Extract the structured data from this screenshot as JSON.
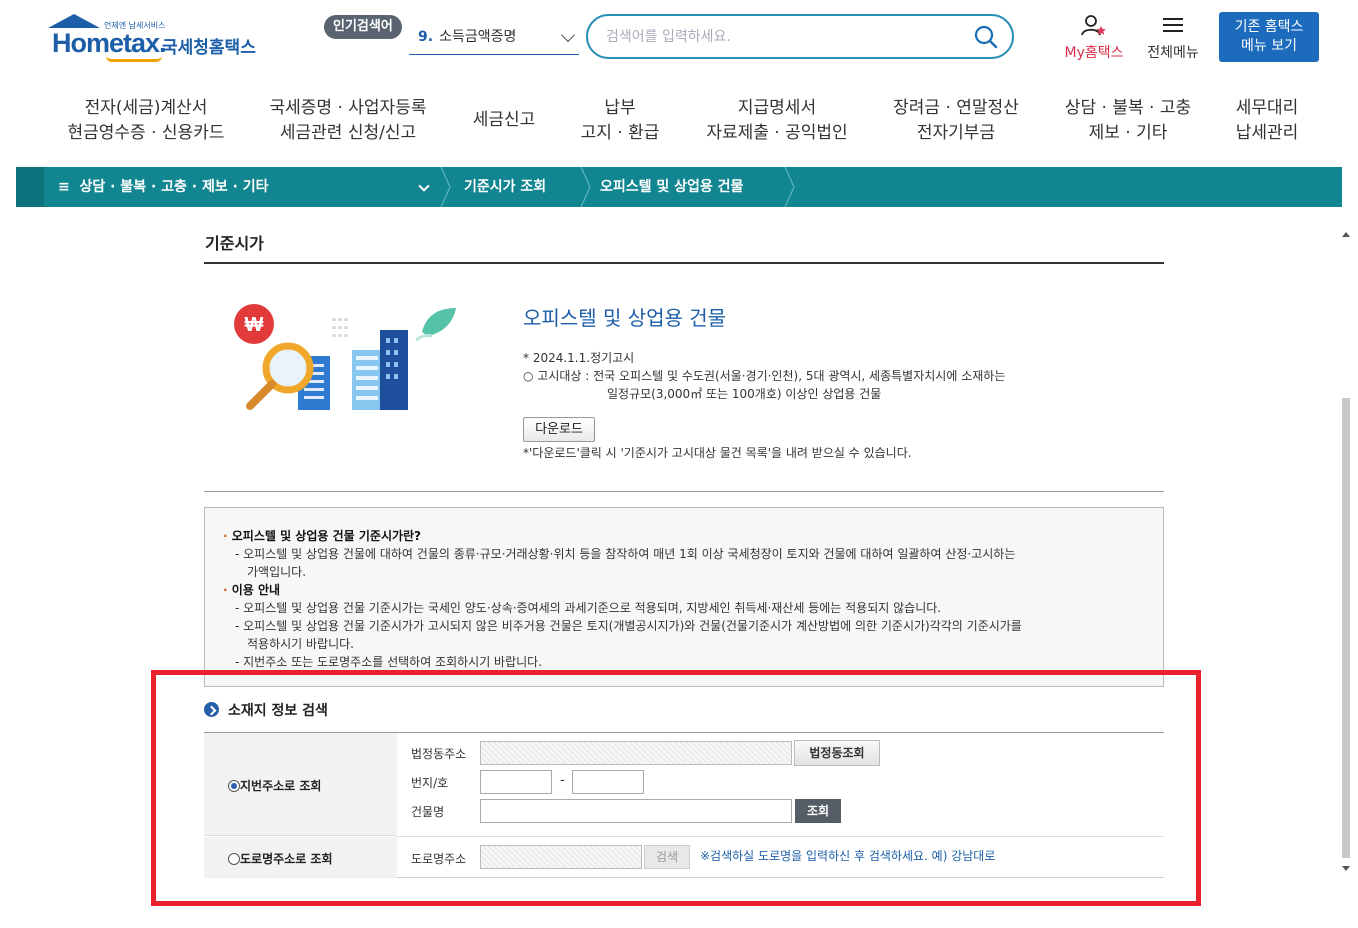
{
  "header": {
    "logo_sub": "언제엔 납세서비스",
    "logo_main": "Hometax.",
    "logo_kr": "국세청홈택스",
    "popular_badge": "인기검색어",
    "popular_rank": "9.",
    "popular_term": "소득금액증명",
    "search_placeholder": "검색어를 입력하세요.",
    "my_hometax": "My홈택스",
    "full_menu": "전체메뉴",
    "old_menu_line1": "기존 홈택스",
    "old_menu_line2": "메뉴 보기"
  },
  "gnb": [
    {
      "line1": "전자(세금)계산서",
      "line2": "현금영수증 · 신용카드"
    },
    {
      "line1": "국세증명 · 사업자등록",
      "line2": "세금관련 신청/신고"
    },
    {
      "line1": "세금신고",
      "line2": ""
    },
    {
      "line1": "납부",
      "line2": "고지 · 환급"
    },
    {
      "line1": "지급명세서",
      "line2": "자료제출 · 공익법인"
    },
    {
      "line1": "장려금 · 연말정산",
      "line2": "전자기부금"
    },
    {
      "line1": "상담 · 불복 · 고충",
      "line2": "제보 · 기타"
    },
    {
      "line1": "세무대리",
      "line2": "납세관리"
    }
  ],
  "breadcrumb": {
    "menu": "상담 · 불복 · 고충 · 제보 · 기타",
    "item1": "기준시가 조회",
    "item2": "오피스텔 및 상업용 건물"
  },
  "content": {
    "page_title": "기준시가",
    "section_title": "오피스텔 및 상업용 건물",
    "notice_date": "* 2024.1.1.정기고시",
    "notice_target1": "○ 고시대상 : 전국 오피스텔 및 수도권(서울·경기·인천), 5대 광역시, 세종특별자치시에 소재하는",
    "notice_target2": "일정규모(3,000㎡ 또는 100개호) 이상인 상업용 건물",
    "download_label": "다운로드",
    "download_note": "*'다운로드'클릭 시 '기준시가 고시대상 물건 목록'을 내려 받으실 수 있습니다."
  },
  "guide": {
    "q_title": "오피스텔 및 상업용 건물 기준시가란?",
    "q_desc1": "- 오피스텔 및 상업용 건물에 대하여 건물의 종류·규모·거래상황·위치 등을 참작하여 매년 1회 이상 국세청장이 토지와 건물에 대하여 일괄하여 산정·고시하는",
    "q_desc2": "가액입니다.",
    "use_title": "이용 안내",
    "use1": "- 오피스텔 및 상업용 건물 기준시가는 국세인 양도·상속·증여세의 과세기준으로 적용되며, 지방세인 취득세·재산세 등에는 적용되지 않습니다.",
    "use2a": "- 오피스텔 및 상업용 건물 기준시가가 고시되지 않은 비주거용 건물은 토지(개별공시지가)와 건물(건물기준시가 계산방법에 의한 기준시가)각각의 기준시가를",
    "use2b": "적용하시기 바랍니다.",
    "use3": "- 지번주소 또는 도로명주소를 선택하여 조회하시기 바랍니다."
  },
  "search": {
    "title": "소재지 정보 검색",
    "radio_jibun": "지번주소로 조회",
    "radio_road": "도로명주소로 조회",
    "label_legal_dong": "법정동주소",
    "btn_legal_dong": "법정동조회",
    "label_bunji": "번지/호",
    "dash": "-",
    "label_building": "건물명",
    "btn_search": "조회",
    "label_road": "도로명주소",
    "btn_road_search": "검색",
    "road_hint": "※검색하실 도로명을 입력하신 후 검색하세요. 예) 강남대로"
  }
}
